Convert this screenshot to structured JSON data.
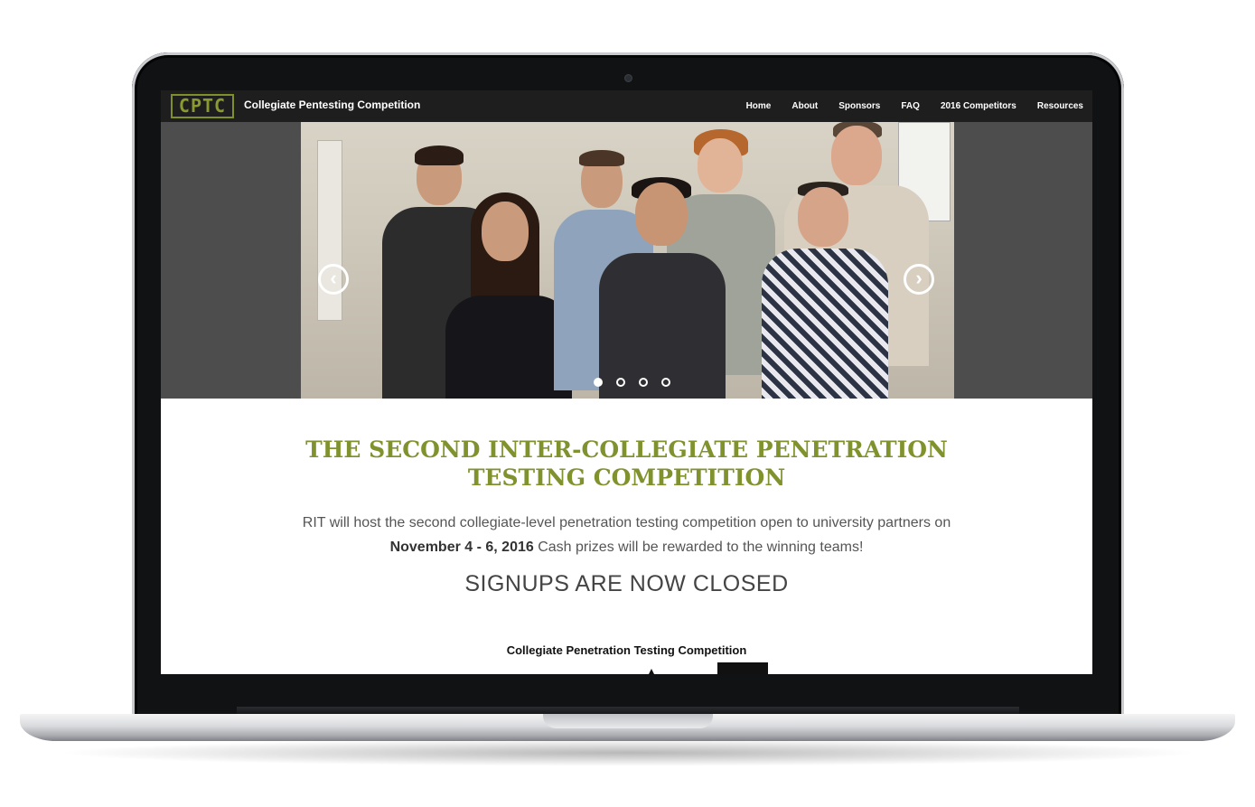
{
  "navbar": {
    "logo_text": "CPTC",
    "brand": "Collegiate Pentesting Competition",
    "items": [
      {
        "label": "Home"
      },
      {
        "label": "About"
      },
      {
        "label": "Sponsors"
      },
      {
        "label": "FAQ"
      },
      {
        "label": "2016 Competitors"
      },
      {
        "label": "Resources"
      }
    ]
  },
  "carousel": {
    "prev_icon": "chevron-left-icon",
    "next_icon": "chevron-right-icon",
    "prev_glyph": "‹",
    "next_glyph": "›",
    "slide_count": 4,
    "active_slide": 1
  },
  "main": {
    "headline_line1": "THE SECOND INTER-COLLEGIATE PENETRATION",
    "headline_line2": "TESTING COMPETITION",
    "intro_part1": "RIT will host the second collegiate-level penetration testing competition open to university partners on ",
    "intro_date": "November 4 - 6, 2016",
    "intro_part2": " Cash prizes will be rewarded to the winning teams!",
    "signups_status": "SIGNUPS ARE NOW CLOSED",
    "graphic_title": "Collegiate Penetration Testing Competition"
  },
  "colors": {
    "accent_green": "#7f922d",
    "navbar_bg": "#1e1e1e",
    "hero_side_bg": "#4d4d4d"
  }
}
